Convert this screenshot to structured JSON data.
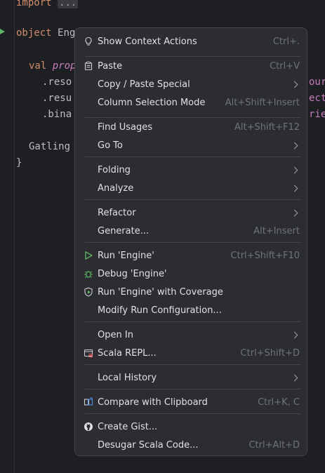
{
  "editor": {
    "line_import_kw": "import",
    "line_import_fold": "...",
    "line_object_kw": "object",
    "line_object_name": "Eng",
    "line_val_kw": "val",
    "line_val_name": "prop",
    "line_resou": ".reso",
    "line_resul": ".resu",
    "line_binar": ".bina",
    "line_gatling": "Gatling",
    "line_brace": "}",
    "right_frag_1": "our",
    "right_frag_2": "ect",
    "right_frag_3": "rie"
  },
  "menu": {
    "show_context_actions": {
      "label": "Show Context Actions",
      "shortcut": "Ctrl+."
    },
    "paste": {
      "label": "Paste",
      "shortcut": "Ctrl+V"
    },
    "copy_paste_special": {
      "label": "Copy / Paste Special"
    },
    "column_selection_mode": {
      "label": "Column Selection Mode",
      "shortcut": "Alt+Shift+Insert"
    },
    "find_usages": {
      "label": "Find Usages",
      "shortcut": "Alt+Shift+F12"
    },
    "go_to": {
      "label": "Go To"
    },
    "folding": {
      "label": "Folding"
    },
    "analyze": {
      "label": "Analyze"
    },
    "refactor": {
      "label": "Refactor"
    },
    "generate": {
      "label": "Generate...",
      "shortcut": "Alt+Insert"
    },
    "run_engine": {
      "label": "Run 'Engine'",
      "shortcut": "Ctrl+Shift+F10"
    },
    "debug_engine": {
      "label": "Debug 'Engine'"
    },
    "run_with_coverage": {
      "label": "Run 'Engine' with Coverage"
    },
    "modify_run_configuration": {
      "label": "Modify Run Configuration..."
    },
    "open_in": {
      "label": "Open In"
    },
    "scala_repl": {
      "label": "Scala REPL...",
      "shortcut": "Ctrl+Shift+D"
    },
    "local_history": {
      "label": "Local History"
    },
    "compare_with_clipboard": {
      "label": "Compare with Clipboard",
      "shortcut": "Ctrl+K, C"
    },
    "create_gist": {
      "label": "Create Gist..."
    },
    "desugar_scala_code": {
      "label": "Desugar Scala Code...",
      "shortcut": "Ctrl+Alt+D"
    }
  },
  "colors": {
    "run_green": "#5fb865",
    "menu_bg": "#2b2d30"
  }
}
